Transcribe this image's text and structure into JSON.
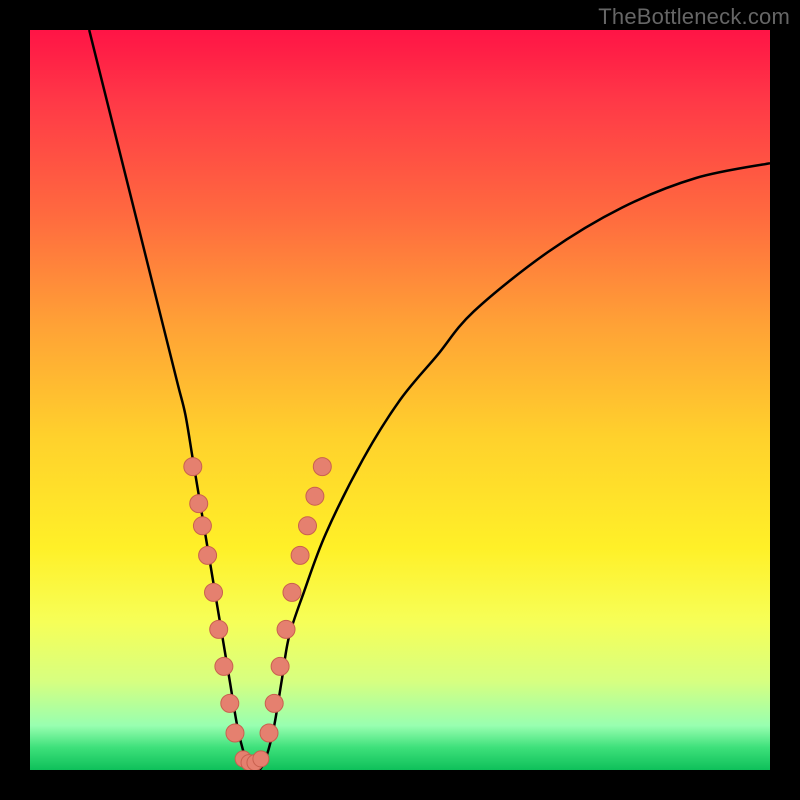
{
  "watermark": "TheBottleneck.com",
  "colors": {
    "marker_fill": "#e5806f",
    "marker_stroke": "#c9604f",
    "curve_stroke": "#000000",
    "frame_bg": "#000000"
  },
  "chart_data": {
    "type": "line",
    "title": "",
    "xlabel": "",
    "ylabel": "",
    "xlim": [
      0,
      100
    ],
    "ylim": [
      0,
      100
    ],
    "x": [
      8,
      10,
      12,
      14,
      16,
      18,
      20,
      21,
      22,
      23,
      24,
      25,
      26,
      27,
      28,
      29,
      30,
      31,
      32,
      33,
      34,
      35,
      37,
      40,
      45,
      50,
      55,
      60,
      70,
      80,
      90,
      100
    ],
    "values": [
      100,
      92,
      84,
      76,
      68,
      60,
      52,
      48,
      42,
      36,
      30,
      24,
      18,
      12,
      6,
      2,
      0,
      0,
      2,
      6,
      12,
      18,
      24,
      32,
      42,
      50,
      56,
      62,
      70,
      76,
      80,
      82
    ],
    "markers_left": [
      {
        "x": 22.0,
        "y": 41
      },
      {
        "x": 22.8,
        "y": 36
      },
      {
        "x": 23.3,
        "y": 33
      },
      {
        "x": 24.0,
        "y": 29
      },
      {
        "x": 24.8,
        "y": 24
      },
      {
        "x": 25.5,
        "y": 19
      },
      {
        "x": 26.2,
        "y": 14
      },
      {
        "x": 27.0,
        "y": 9
      },
      {
        "x": 27.7,
        "y": 5
      }
    ],
    "markers_bottom": [
      {
        "x": 28.8,
        "y": 1.5
      },
      {
        "x": 29.6,
        "y": 1.0
      },
      {
        "x": 30.4,
        "y": 1.0
      },
      {
        "x": 31.2,
        "y": 1.5
      }
    ],
    "markers_right": [
      {
        "x": 32.3,
        "y": 5
      },
      {
        "x": 33.0,
        "y": 9
      },
      {
        "x": 33.8,
        "y": 14
      },
      {
        "x": 34.6,
        "y": 19
      },
      {
        "x": 35.4,
        "y": 24
      },
      {
        "x": 36.5,
        "y": 29
      },
      {
        "x": 37.5,
        "y": 33
      },
      {
        "x": 38.5,
        "y": 37
      },
      {
        "x": 39.5,
        "y": 41
      }
    ]
  }
}
